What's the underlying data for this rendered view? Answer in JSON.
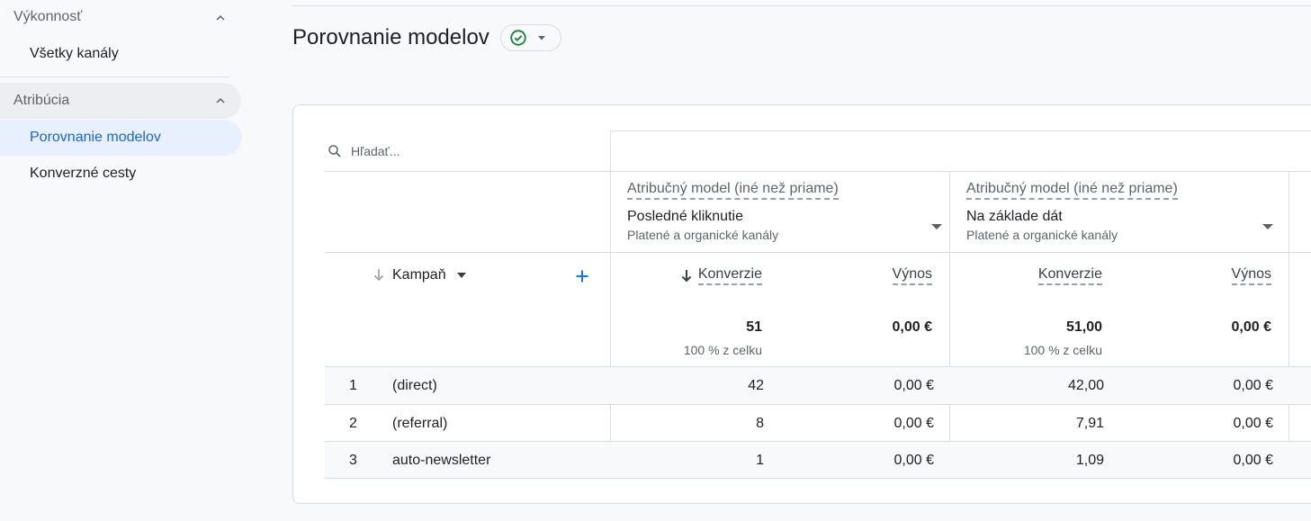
{
  "sidebar": {
    "section1": {
      "label": "Výkonnosť",
      "items": [
        {
          "label": "Všetky kanály"
        }
      ]
    },
    "section2": {
      "label": "Atribúcia",
      "items": [
        {
          "label": "Porovnanie modelov",
          "active": true
        },
        {
          "label": "Konverzné cesty"
        }
      ]
    }
  },
  "page": {
    "title": "Porovnanie modelov",
    "status_icon": "check-circle-icon"
  },
  "table": {
    "search_placeholder": "Hľadať...",
    "models": [
      {
        "label": "Atribučný model (iné než priame)",
        "selected": "Posledné kliknutie",
        "channels": "Platené a organické kanály"
      },
      {
        "label": "Atribučný model (iné než priame)",
        "selected": "Na základe dát",
        "channels": "Platené a organické kanály"
      }
    ],
    "dimension": "Kampaň",
    "metrics": [
      "Konverzie",
      "Výnos",
      "Konverzie",
      "Výnos"
    ],
    "totals": [
      "51",
      "0,00 €",
      "51,00",
      "0,00 €"
    ],
    "totals_sub": [
      "100 % z celku",
      "100 % z celku"
    ],
    "rows": [
      {
        "n": "1",
        "name": "(direct)",
        "c1": "42",
        "r1": "0,00 €",
        "c2": "42,00",
        "r2": "0,00 €"
      },
      {
        "n": "2",
        "name": "(referral)",
        "c1": "8",
        "r1": "0,00 €",
        "c2": "7,91",
        "r2": "0,00 €"
      },
      {
        "n": "3",
        "name": "auto-newsletter",
        "c1": "1",
        "r1": "0,00 €",
        "c2": "1,09",
        "r2": "0,00 €"
      }
    ]
  },
  "colors": {
    "accent": "#1967d2",
    "active_bg": "#e8f0fe",
    "success": "#188038"
  }
}
